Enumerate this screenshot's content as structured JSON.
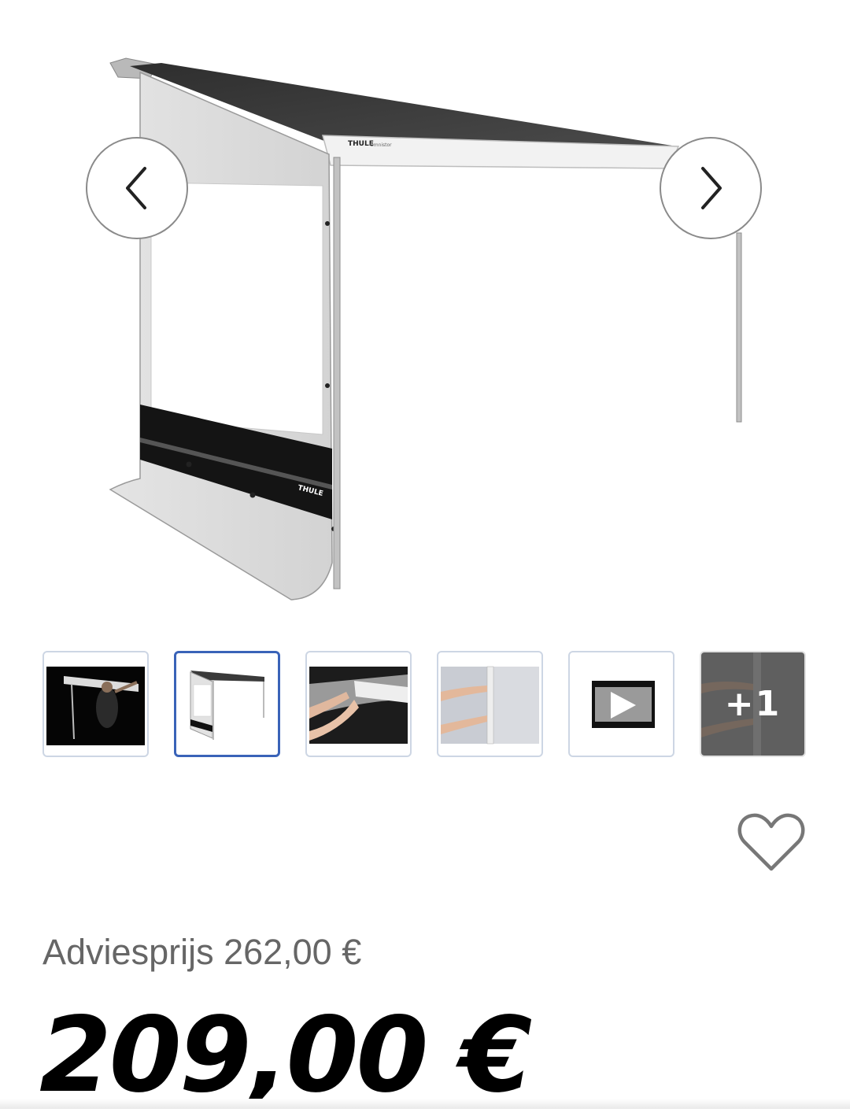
{
  "gallery": {
    "main_image": {
      "brand_mark": "THULE",
      "product_mark": "Omnistor"
    },
    "prev_icon": "chevron-left-icon",
    "next_icon": "chevron-right-icon",
    "thumbnails": [
      {
        "kind": "image",
        "subject": "person installing awning"
      },
      {
        "kind": "image",
        "subject": "awning with side panel",
        "active": true
      },
      {
        "kind": "image",
        "subject": "hands fitting panel into rail"
      },
      {
        "kind": "image",
        "subject": "hands attaching clip"
      },
      {
        "kind": "video",
        "icon": "play-icon"
      },
      {
        "kind": "more",
        "label": "+1"
      }
    ]
  },
  "favorite": {
    "icon": "heart-outline-icon"
  },
  "pricing": {
    "msrp_text": "Adviesprijs 262,00 €",
    "price_text": "209,00 €"
  },
  "colors": {
    "active_thumb_border": "#3a63b8",
    "thumb_border": "#cdd6e4",
    "msrp_text": "#666666",
    "price_text": "#000000"
  }
}
